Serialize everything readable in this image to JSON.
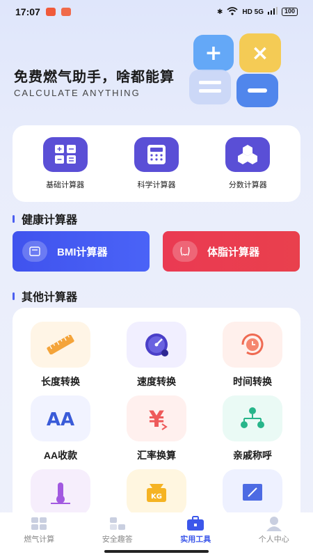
{
  "status_bar": {
    "time": "17:07",
    "network": "HD 5G",
    "battery": "100"
  },
  "hero": {
    "title": "免费燃气助手，啥都能算",
    "subtitle": "CALCULATE ANYTHING"
  },
  "basic_tools": [
    {
      "label": "基础计算器",
      "icon": "basic-calculator-icon"
    },
    {
      "label": "科学计算器",
      "icon": "scientific-calculator-icon"
    },
    {
      "label": "分数计算器",
      "icon": "fraction-calculator-icon"
    }
  ],
  "health_section": {
    "title": "健康计算器",
    "bmi_label": "BMI计算器",
    "bodyfat_label": "体脂计算器"
  },
  "other_section": {
    "title": "其他计算器",
    "tools": [
      {
        "label": "长度转换",
        "icon": "ruler-icon"
      },
      {
        "label": "速度转换",
        "icon": "speedometer-icon"
      },
      {
        "label": "时间转换",
        "icon": "clock-icon"
      },
      {
        "label": "AA收款",
        "icon": "aa-icon"
      },
      {
        "label": "汇率换算",
        "icon": "yen-exchange-icon"
      },
      {
        "label": "亲戚称呼",
        "icon": "family-tree-icon"
      },
      {
        "label": "",
        "icon": "temperature-icon"
      },
      {
        "label": "",
        "icon": "weight-icon"
      },
      {
        "label": "",
        "icon": "area-icon"
      }
    ]
  },
  "tab_bar": {
    "tabs": [
      {
        "label": "燃气计算",
        "active": false
      },
      {
        "label": "安全趣答",
        "active": false
      },
      {
        "label": "实用工具",
        "active": true
      },
      {
        "label": "个人中心",
        "active": false
      }
    ]
  },
  "colors": {
    "accent": "#3c57ea",
    "basic_icon_bg": "#5a4fd6",
    "bmi": "#4053ee",
    "bodyfat": "#ea3a52"
  }
}
